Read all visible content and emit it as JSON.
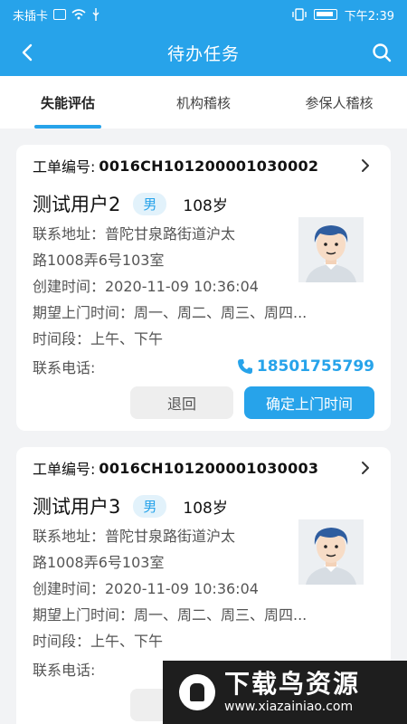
{
  "status_bar": {
    "left_text": "未插卡",
    "time": "下午2:39"
  },
  "nav": {
    "title": "待办任务"
  },
  "tabs": [
    {
      "label": "失能评估",
      "active": true
    },
    {
      "label": "机构稽核",
      "active": false
    },
    {
      "label": "参保人稽核",
      "active": false
    }
  ],
  "cards": [
    {
      "order_label": "工单编号:",
      "order_no": "0016CH101200001030002",
      "name": "测试用户2",
      "gender": "男",
      "age": "108岁",
      "address_line1": "联系地址：普陀甘泉路街道沪太",
      "address_line2": "路1008弄6号103室",
      "created": "创建时间：2020-11-09 10:36:04",
      "expected_visit": "期望上门时间：周一、周二、周三、周四...",
      "time_slot": "时间段：上午、下午",
      "phone_label": "联系电话:",
      "phone": "18501755799",
      "return_label": "退回",
      "confirm_label": "确定上门时间"
    },
    {
      "order_label": "工单编号:",
      "order_no": "0016CH101200001030003",
      "name": "测试用户3",
      "gender": "男",
      "age": "108岁",
      "address_line1": "联系地址：普陀甘泉路街道沪太",
      "address_line2": "路1008弄6号103室",
      "created": "创建时间：2020-11-09 10:36:04",
      "expected_visit": "期望上门时间：周一、周二、周三、周四...",
      "time_slot": "时间段：上午、下午",
      "phone_label": "联系电话:"
    }
  ],
  "watermark": {
    "title": "下载鸟资源",
    "url": "www.xiazainiao.com"
  },
  "colors": {
    "primary": "#27a3ea",
    "background": "#f2f3f5"
  }
}
